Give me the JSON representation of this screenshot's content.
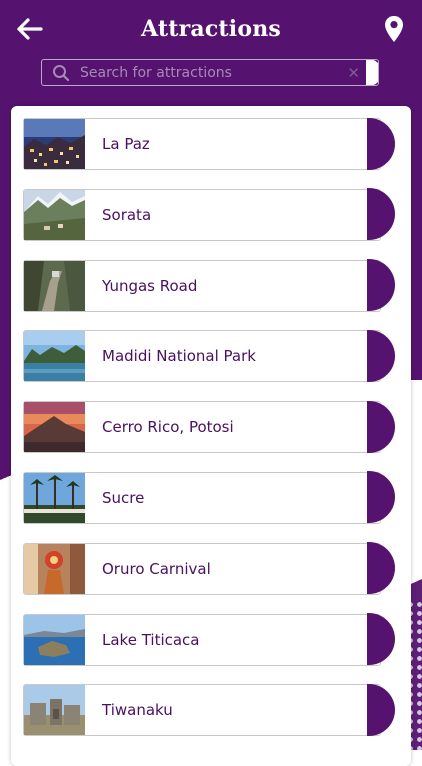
{
  "header": {
    "title": "Attractions"
  },
  "search": {
    "placeholder": "Search for attractions"
  },
  "colors": {
    "primary": "#55136f",
    "label": "#4a1060"
  },
  "attractions": [
    {
      "label": "La Paz"
    },
    {
      "label": "Sorata"
    },
    {
      "label": "Yungas Road"
    },
    {
      "label": "Madidi National Park"
    },
    {
      "label": "Cerro Rico, Potosi"
    },
    {
      "label": "Sucre"
    },
    {
      "label": "Oruro Carnival"
    },
    {
      "label": "Lake Titicaca"
    },
    {
      "label": "Tiwanaku"
    }
  ]
}
